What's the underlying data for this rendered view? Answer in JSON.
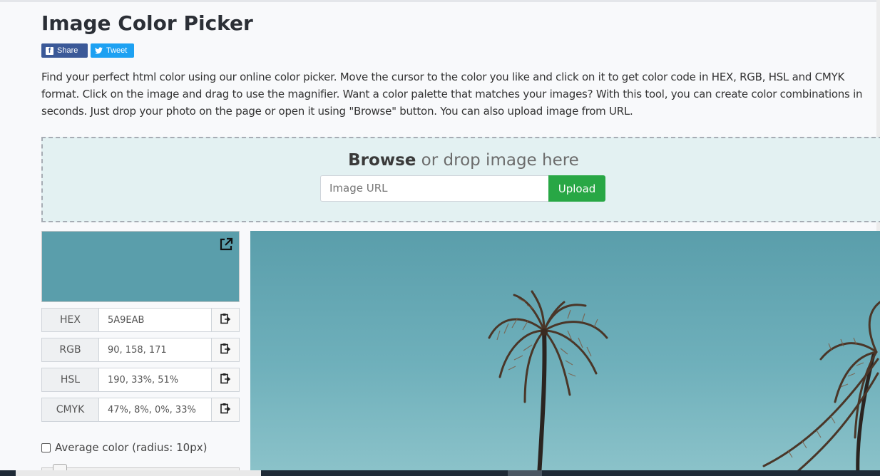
{
  "page": {
    "title": "Image Color Picker",
    "description": "Find your perfect html color using our online color picker. Move the cursor to the color you like and click on it to get color code in HEX, RGB, HSL and CMYK format. Click on the image and drag to use the magnifier. Want a color palette that matches your images? With this tool, you can create color combinations in seconds. Just drop your photo on the page or open it using \"Browse\" button. You can also upload image from URL."
  },
  "social": {
    "share_label": "Share",
    "tweet_label": "Tweet",
    "facebook_color": "#3b5998",
    "twitter_color": "#1da1f2"
  },
  "dropzone": {
    "browse_label": "Browse",
    "drop_text": " or drop image here",
    "url_placeholder": "Image URL",
    "upload_label": "Upload",
    "upload_color": "#28a745"
  },
  "picker": {
    "swatch_color": "#5A9EAB",
    "rows": [
      {
        "label": "HEX",
        "value": "5A9EAB"
      },
      {
        "label": "RGB",
        "value": "90, 158, 171"
      },
      {
        "label": "HSL",
        "value": "190, 33%, 51%"
      },
      {
        "label": "CMYK",
        "value": "47%, 8%, 0%, 33%"
      }
    ],
    "average_label": "Average color (radius: 10px)",
    "average_checked": false
  }
}
